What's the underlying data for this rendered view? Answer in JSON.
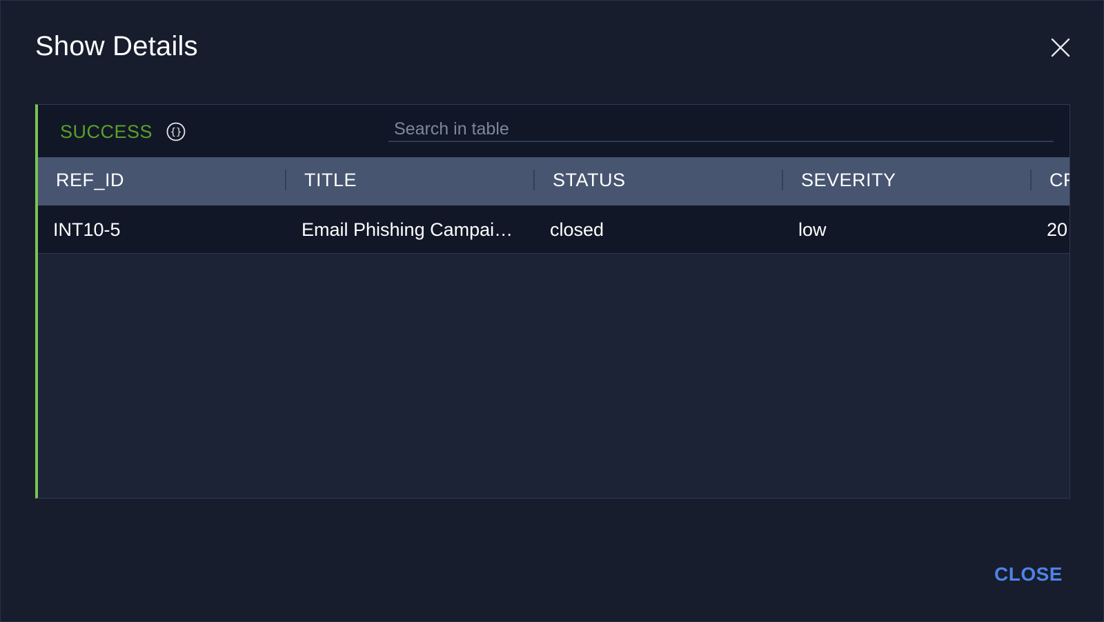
{
  "dialog": {
    "title": "Show Details",
    "close_button_label": "CLOSE"
  },
  "panel": {
    "status": "SUCCESS",
    "search_placeholder": "Search in table",
    "columns": [
      "REF_ID",
      "TITLE",
      "STATUS",
      "SEVERITY",
      "CR"
    ],
    "rows": [
      {
        "ref_id": "INT10-5",
        "title": "Email Phishing Campai…",
        "status": "closed",
        "severity": "low",
        "cr": "20"
      }
    ]
  },
  "colors": {
    "success": "#5aa02c",
    "accent_border": "#7cc354",
    "header_bg": "#475571",
    "link": "#4e83e8"
  },
  "icons": {
    "close": "close-icon",
    "json": "json-braces-icon"
  }
}
